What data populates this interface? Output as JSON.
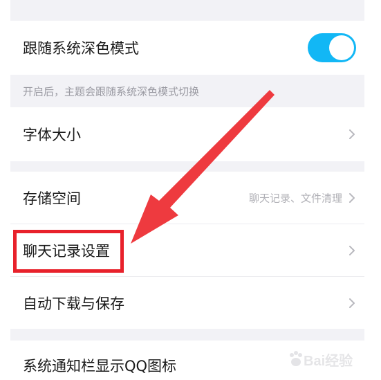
{
  "settings": {
    "follow_dark_mode": {
      "label": "跟随系统深色模式",
      "enabled": true,
      "hint": "开启后，主题会跟随系统深色模式切换"
    },
    "font_size": {
      "label": "字体大小"
    },
    "storage": {
      "label": "存储空间",
      "value": "聊天记录、文件清理"
    },
    "chat_history": {
      "label": "聊天记录设置"
    },
    "auto_download": {
      "label": "自动下载与保存"
    },
    "notification_icon": {
      "label": "系统通知栏显示QQ图标"
    }
  },
  "colors": {
    "toggle_on": "#12b7f5",
    "highlight": "#e8212b",
    "section_gap": "#f2f2f6"
  },
  "icons": {
    "row_chevron": "chevron-right-icon",
    "annotation": "arrow-icon"
  },
  "watermark": {
    "text": "Bai经验"
  }
}
